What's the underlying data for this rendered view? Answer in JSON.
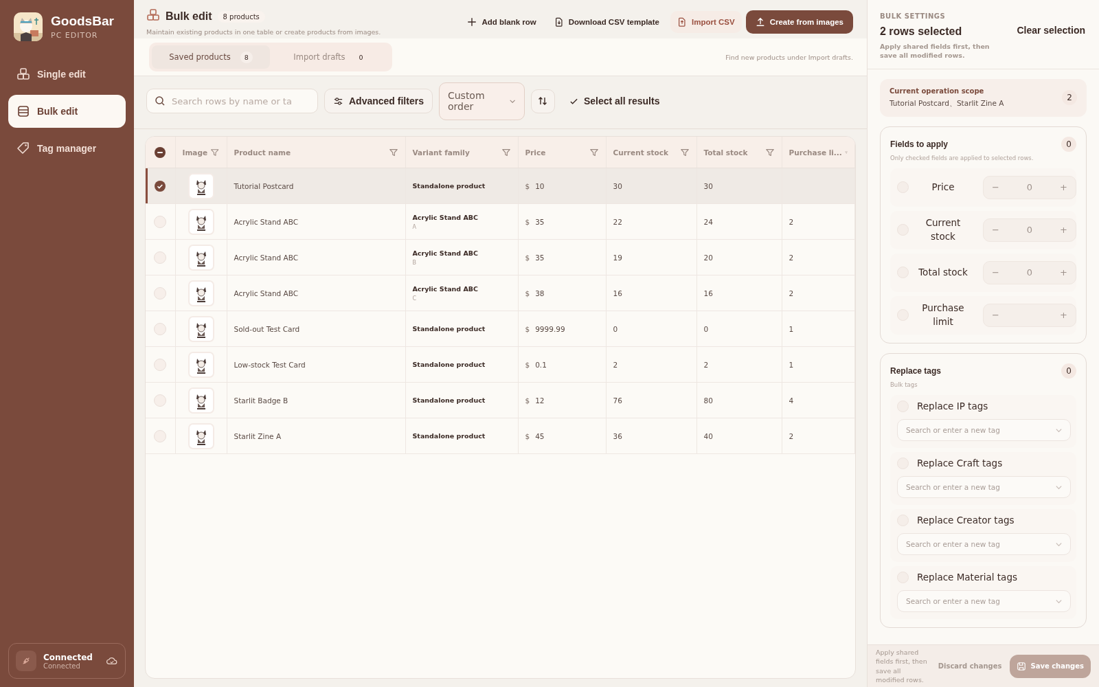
{
  "app": {
    "name": "GoodsBar",
    "subtitle": "PC EDITOR"
  },
  "nav": [
    {
      "label": "Single edit",
      "selected": false
    },
    {
      "label": "Bulk edit",
      "selected": true
    },
    {
      "label": "Tag manager",
      "selected": false
    }
  ],
  "connection": {
    "title": "Connected",
    "status": "Connected"
  },
  "header": {
    "title": "Bulk edit",
    "count": "8 products",
    "description": "Maintain existing products in one table or create products from images.",
    "actions": [
      {
        "label": "Add blank row",
        "kind": "plain"
      },
      {
        "label": "Download CSV template",
        "kind": "plain"
      },
      {
        "label": "Import CSV",
        "kind": "accent"
      },
      {
        "label": "Create from images",
        "kind": "primary"
      }
    ]
  },
  "tabs": [
    {
      "label": "Saved products",
      "count": "8",
      "selected": true
    },
    {
      "label": "Import drafts",
      "count": "0",
      "selected": false
    }
  ],
  "tabs_hint": "Find new products under Import drafts.",
  "toolbar": {
    "search_placeholder": "Search rows by name or ta",
    "filters": "Advanced filters",
    "sort": "Custom order",
    "select_all": "Select all results"
  },
  "table": {
    "header_partial": true,
    "columns": [
      {
        "label": "Image"
      },
      {
        "label": "Product name"
      },
      {
        "label": "Variant family"
      },
      {
        "label": "Price"
      },
      {
        "label": "Current stock"
      },
      {
        "label": "Total stock"
      },
      {
        "label": "Purchase li..."
      }
    ],
    "rows": [
      {
        "selected": true,
        "name": "Tutorial Postcard",
        "family": "Standalone product",
        "currency": "$",
        "price": "10",
        "current_stock": "30",
        "total_stock": "30"
      },
      {
        "selected": false,
        "name": "Acrylic Stand ABC",
        "family": "Acrylic Stand ABC",
        "variant": "A",
        "currency": "$",
        "price": "35",
        "current_stock": "22",
        "total_stock": "24",
        "purchase_limit": "2"
      },
      {
        "selected": false,
        "name": "Acrylic Stand ABC",
        "family": "Acrylic Stand ABC",
        "variant": "B",
        "currency": "$",
        "price": "35",
        "current_stock": "19",
        "total_stock": "20",
        "purchase_limit": "2"
      },
      {
        "selected": false,
        "name": "Acrylic Stand ABC",
        "family": "Acrylic Stand ABC",
        "variant": "C",
        "currency": "$",
        "price": "38",
        "current_stock": "16",
        "total_stock": "16",
        "purchase_limit": "2"
      },
      {
        "selected": false,
        "name": "Sold-out Test Card",
        "family": "Standalone product",
        "currency": "$",
        "price": "9999.99",
        "current_stock": "0",
        "total_stock": "0",
        "purchase_limit": "1"
      },
      {
        "selected": false,
        "name": "Low-stock Test Card",
        "family": "Standalone product",
        "currency": "$",
        "price": "0.1",
        "current_stock": "2",
        "total_stock": "2",
        "purchase_limit": "1"
      },
      {
        "selected": false,
        "name": "Starlit Badge B",
        "family": "Standalone product",
        "currency": "$",
        "price": "12",
        "current_stock": "76",
        "total_stock": "80",
        "purchase_limit": "4"
      },
      {
        "selected": false,
        "name": "Starlit Zine A",
        "family": "Standalone product",
        "currency": "$",
        "price": "45",
        "current_stock": "36",
        "total_stock": "40",
        "purchase_limit": "2"
      }
    ]
  },
  "bulk": {
    "eyebrow": "BULK SETTINGS",
    "title": "2 rows selected",
    "clear": "Clear selection",
    "note": "Apply shared fields first, then save all modified rows.",
    "scope": {
      "label": "Current operation scope",
      "items": "Tutorial Postcard、Starlit Zine A",
      "count": "2"
    },
    "fields": {
      "title": "Fields to apply",
      "count": "0",
      "hint": "Only checked fields are applied to selected rows.",
      "items": [
        {
          "label": "Price",
          "checked": false,
          "disabled": true,
          "minus": "−",
          "value": "0",
          "plus": "+"
        },
        {
          "label": "Current stock",
          "checked": false,
          "disabled": true,
          "minus": "−",
          "value": "0",
          "plus": "+"
        },
        {
          "label": "Total stock",
          "checked": false,
          "disabled": true,
          "minus": "−",
          "value": "0",
          "plus": "+"
        },
        {
          "label": "Purchase limit",
          "checked": false,
          "disabled": true,
          "minus": "−",
          "plus": "+"
        }
      ]
    },
    "tags": {
      "title": "Replace tags",
      "count": "0",
      "hint": "Bulk tags",
      "items": [
        {
          "label": "Replace IP tags",
          "checked": false,
          "placeholder": "Search or enter a new tag"
        },
        {
          "label": "Replace Craft tags",
          "checked": false,
          "placeholder": "Search or enter a new tag"
        },
        {
          "label": "Replace Creator tags",
          "checked": false,
          "placeholder": "Search or enter a new tag"
        },
        {
          "label": "Replace Material tags",
          "checked": false,
          "placeholder": "Search or enter a new tag"
        }
      ]
    },
    "footer": {
      "note": "Apply shared fields first, then save all modified rows.",
      "discard": "Discard changes",
      "save": "Save changes"
    }
  }
}
